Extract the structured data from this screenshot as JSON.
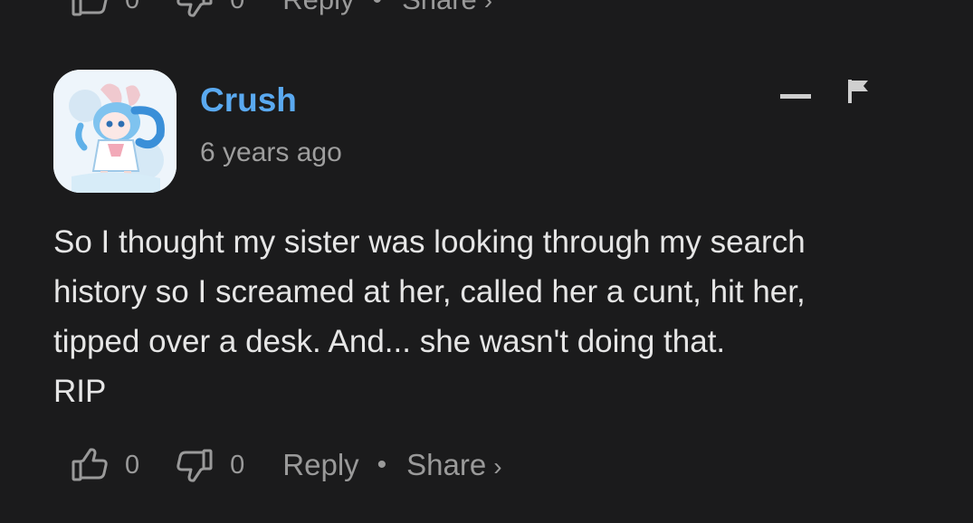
{
  "previous_comment_actions": {
    "like_count": "0",
    "dislike_count": "0",
    "reply_label": "Reply",
    "separator": "•",
    "share_label": "Share",
    "share_arrow": "›"
  },
  "comment": {
    "username": "Crush",
    "timestamp": "6 years ago",
    "avatar_icon": "anime-avatar-icon",
    "body_lines": [
      "So I thought my sister was looking through my search",
      "history so I screamed at her, called her a cunt, hit her,",
      "tipped over a desk. And... she wasn't doing that.",
      "RIP"
    ],
    "menu_icons": [
      "collapse-icon",
      "flag-icon"
    ],
    "actions": {
      "like_count": "0",
      "dislike_count": "0",
      "reply_label": "Reply",
      "separator": "•",
      "share_label": "Share",
      "share_arrow": "›"
    }
  },
  "colors": {
    "background": "#1b1b1c",
    "username": "#5aa9f0",
    "text": "#e6e6e6",
    "muted": "#9a9a9a"
  }
}
